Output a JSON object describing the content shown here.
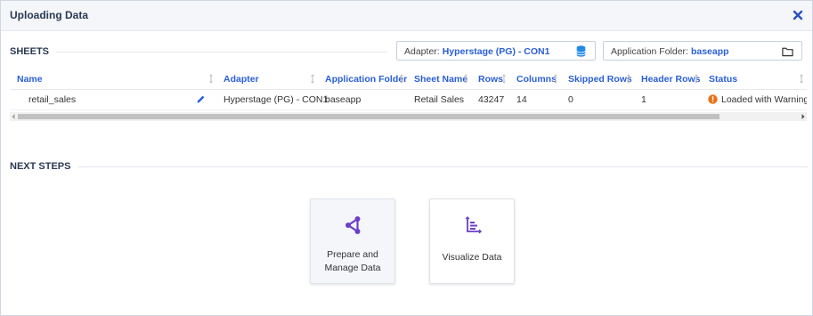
{
  "dialog": {
    "title": "Uploading Data"
  },
  "sheets": {
    "section_title": "SHEETS",
    "adapter_picker": {
      "label": "Adapter:",
      "value": "Hyperstage (PG) - CON1",
      "icon": "database-icon"
    },
    "folder_picker": {
      "label": "Application Folder:",
      "value": "baseapp",
      "icon": "folder-icon"
    },
    "columns": [
      "Name",
      "Adapter",
      "Application Folder",
      "Sheet Name",
      "Rows",
      "Columns",
      "Skipped Rows",
      "Header Rows",
      "Status"
    ],
    "rows": [
      {
        "name": "retail_sales",
        "adapter": "Hyperstage (PG) - CON1",
        "folder": "baseapp",
        "sheet": "Retail Sales",
        "rows": "43247",
        "columns": "14",
        "skipped": "0",
        "header": "1",
        "status": "Loaded with Warning"
      }
    ]
  },
  "next_steps": {
    "section_title": "NEXT STEPS",
    "cards": [
      {
        "label": "Prepare and Manage Data",
        "icon": "share-nodes-icon"
      },
      {
        "label": "Visualize Data",
        "icon": "bar-chart-icon"
      }
    ]
  },
  "colors": {
    "accent": "#2a5fd6",
    "icon_purple": "#6b3fc6",
    "warning": "#e8711a",
    "db_blue": "#1e88e5"
  }
}
